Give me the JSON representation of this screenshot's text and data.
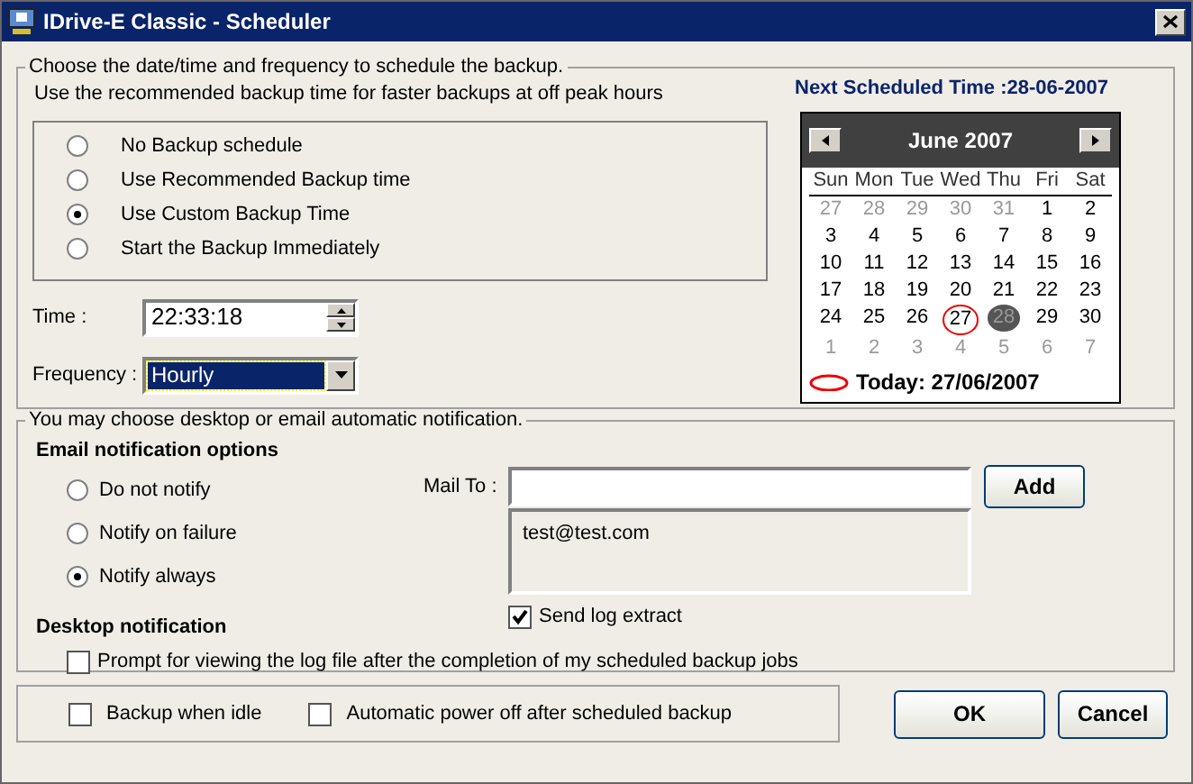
{
  "window": {
    "title": "IDrive-E Classic - Scheduler"
  },
  "schedule": {
    "legend": "Choose the date/time and frequency to schedule the backup.",
    "hint": "Use the recommended backup time for faster backups at off peak hours",
    "options": [
      {
        "label": "No Backup schedule",
        "selected": false
      },
      {
        "label": "Use Recommended Backup time",
        "selected": false
      },
      {
        "label": "Use Custom Backup Time",
        "selected": true
      },
      {
        "label": "Start the Backup Immediately",
        "selected": false
      }
    ],
    "time": {
      "label": "Time :",
      "value": "22:33:18"
    },
    "frequency": {
      "label": "Frequency :",
      "value": "Hourly"
    }
  },
  "calendar": {
    "next_scheduled": "Next Scheduled Time :28-06-2007",
    "month": "June 2007",
    "weekdays": [
      "Sun",
      "Mon",
      "Tue",
      "Wed",
      "Thu",
      "Fri",
      "Sat"
    ],
    "weeks": [
      [
        {
          "day": "27",
          "kind": "other"
        },
        {
          "day": "28",
          "kind": "other"
        },
        {
          "day": "29",
          "kind": "other"
        },
        {
          "day": "30",
          "kind": "other"
        },
        {
          "day": "31",
          "kind": "other"
        },
        {
          "day": "1",
          "kind": "day"
        },
        {
          "day": "2",
          "kind": "day"
        }
      ],
      [
        {
          "day": "3",
          "kind": "day"
        },
        {
          "day": "4",
          "kind": "day"
        },
        {
          "day": "5",
          "kind": "day"
        },
        {
          "day": "6",
          "kind": "day"
        },
        {
          "day": "7",
          "kind": "day"
        },
        {
          "day": "8",
          "kind": "day"
        },
        {
          "day": "9",
          "kind": "day"
        }
      ],
      [
        {
          "day": "10",
          "kind": "day"
        },
        {
          "day": "11",
          "kind": "day"
        },
        {
          "day": "12",
          "kind": "day"
        },
        {
          "day": "13",
          "kind": "day"
        },
        {
          "day": "14",
          "kind": "day"
        },
        {
          "day": "15",
          "kind": "day"
        },
        {
          "day": "16",
          "kind": "day"
        }
      ],
      [
        {
          "day": "17",
          "kind": "day"
        },
        {
          "day": "18",
          "kind": "day"
        },
        {
          "day": "19",
          "kind": "day"
        },
        {
          "day": "20",
          "kind": "day"
        },
        {
          "day": "21",
          "kind": "day"
        },
        {
          "day": "22",
          "kind": "day"
        },
        {
          "day": "23",
          "kind": "day"
        }
      ],
      [
        {
          "day": "24",
          "kind": "day"
        },
        {
          "day": "25",
          "kind": "day"
        },
        {
          "day": "26",
          "kind": "day"
        },
        {
          "day": "27",
          "kind": "today"
        },
        {
          "day": "28",
          "kind": "selected"
        },
        {
          "day": "29",
          "kind": "day"
        },
        {
          "day": "30",
          "kind": "day"
        }
      ],
      [
        {
          "day": "1",
          "kind": "other"
        },
        {
          "day": "2",
          "kind": "other"
        },
        {
          "day": "3",
          "kind": "other"
        },
        {
          "day": "4",
          "kind": "other"
        },
        {
          "day": "5",
          "kind": "other"
        },
        {
          "day": "6",
          "kind": "other"
        },
        {
          "day": "7",
          "kind": "other"
        }
      ]
    ],
    "today_label": "Today: 27/06/2007"
  },
  "notification": {
    "legend": "You may choose desktop or email automatic notification.",
    "email_heading": "Email notification options",
    "email_options": [
      {
        "label": "Do not notify",
        "selected": false
      },
      {
        "label": "Notify on failure",
        "selected": false
      },
      {
        "label": "Notify always",
        "selected": true
      }
    ],
    "mail_to": {
      "label": "Mail To :"
    },
    "add_button": "Add",
    "recipients": [
      "test@test.com"
    ],
    "send_log": {
      "label": "Send log extract",
      "checked": true
    },
    "desktop_heading": "Desktop notification",
    "prompt": {
      "label": "Prompt for viewing the log file after the completion of my scheduled backup jobs",
      "checked": false
    }
  },
  "options": [
    {
      "label": "Backup when idle",
      "checked": false
    },
    {
      "label": "Automatic power off after scheduled backup",
      "checked": false
    }
  ],
  "buttons": [
    "OK",
    "Cancel"
  ]
}
